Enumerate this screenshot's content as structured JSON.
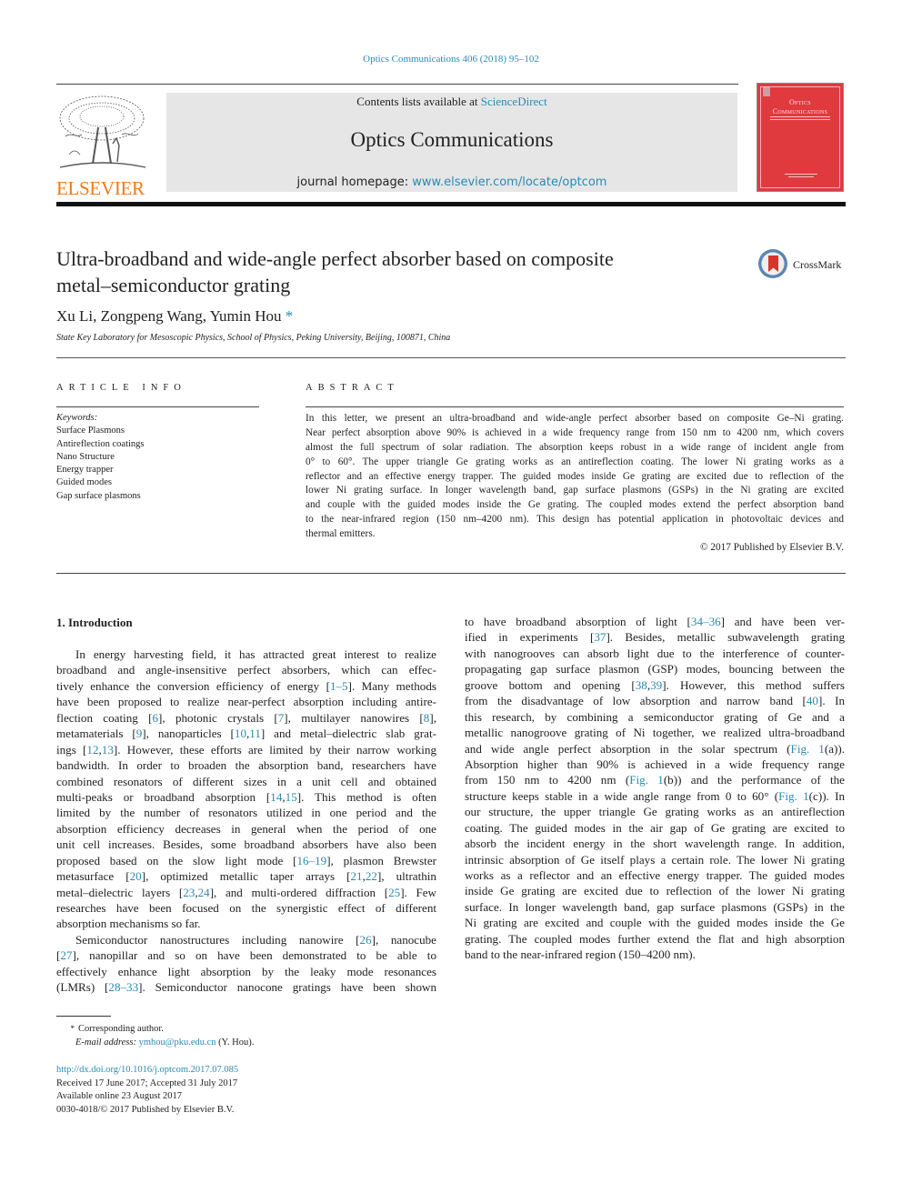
{
  "header": {
    "citation": "Optics Communications 406 (2018) 95–102",
    "publisher_logo_text": "ELSEVIER",
    "contents_prefix": "Contents lists available at ",
    "contents_link": "ScienceDirect",
    "journal_title": "Optics Communications",
    "homepage_prefix": "journal homepage: ",
    "homepage_link": "www.elsevier.com/locate/optcom",
    "cover_title_line1": "Optics",
    "cover_title_line2": "Communications",
    "crossmark_label": "CrossMark",
    "colors": {
      "link": "#2a8ab3",
      "elsevier_orange": "#f07a1a",
      "cover_red": "#e03a3f",
      "masthead_gray": "#e6e6e6"
    }
  },
  "article": {
    "title_line1": "Ultra-broadband and wide-angle perfect absorber based on composite",
    "title_line2": "metal–semiconductor grating",
    "authors": "Xu Li, Zongpeng Wang, Yumin Hou",
    "corresponding_mark": "*",
    "affiliation": "State Key Laboratory for Mesoscopic Physics, School of Physics, Peking University, Beijing, 100871, China"
  },
  "article_info": {
    "heading": "ARTICLE INFO",
    "keywords_label": "Keywords:",
    "keywords": [
      "Surface Plasmons",
      "Antireflection coatings",
      "Nano Structure",
      "Energy trapper",
      "Guided modes",
      "Gap surface plasmons"
    ]
  },
  "abstract": {
    "heading": "ABSTRACT",
    "lines": [
      "In this letter, we present an ultra-broadband and wide-angle perfect absorber based on composite Ge–Ni grating.",
      "Near perfect absorption above 90% is achieved in a wide frequency range from 150 nm to 4200 nm, which covers",
      "almost the full spectrum of solar radiation. The absorption keeps robust in a wide range of incident angle from",
      "0°  to 60°. The upper triangle Ge grating works as an antireflection coating. The lower Ni grating works as a",
      "reflector and an effective energy trapper. The guided modes inside Ge grating are excited due to reflection of the",
      "lower Ni grating surface. In longer wavelength band, gap surface plasmons (GSPs) in the Ni grating are excited",
      "and couple with the guided modes inside the Ge grating. The coupled modes extend the perfect absorption band",
      "to the near-infrared region (150 nm–4200 nm). This design has potential application in photovoltaic devices and",
      "thermal emitters."
    ],
    "copyright": "© 2017 Published by Elsevier B.V."
  },
  "introduction": {
    "heading": "1.  Introduction",
    "col1": [
      {
        "segs": [
          {
            "t": "In energy harvesting field, it has attracted great interest to realize"
          }
        ],
        "indent": true
      },
      {
        "segs": [
          {
            "t": "broadband and angle-insensitive perfect absorbers, which can effec-"
          }
        ]
      },
      {
        "segs": [
          {
            "t": "tively enhance the conversion efficiency of energy ["
          },
          {
            "t": "1–5",
            "l": 1
          },
          {
            "t": "]. Many methods"
          }
        ]
      },
      {
        "segs": [
          {
            "t": "have been proposed to realize near-perfect absorption including antire-"
          }
        ]
      },
      {
        "segs": [
          {
            "t": "flection coating ["
          },
          {
            "t": "6",
            "l": 1
          },
          {
            "t": "], photonic crystals ["
          },
          {
            "t": "7",
            "l": 1
          },
          {
            "t": "], multilayer nanowires ["
          },
          {
            "t": "8",
            "l": 1
          },
          {
            "t": "],"
          }
        ]
      },
      {
        "segs": [
          {
            "t": "metamaterials ["
          },
          {
            "t": "9",
            "l": 1
          },
          {
            "t": "], nanoparticles ["
          },
          {
            "t": "10",
            "l": 1
          },
          {
            "t": ","
          },
          {
            "t": "11",
            "l": 1
          },
          {
            "t": "] and metal–dielectric slab grat-"
          }
        ]
      },
      {
        "segs": [
          {
            "t": "ings ["
          },
          {
            "t": "12",
            "l": 1
          },
          {
            "t": ","
          },
          {
            "t": "13",
            "l": 1
          },
          {
            "t": "]. However, these efforts are limited by their narrow working"
          }
        ]
      },
      {
        "segs": [
          {
            "t": "bandwidth. In order to broaden the absorption band, researchers have"
          }
        ]
      },
      {
        "segs": [
          {
            "t": "combined resonators of different sizes in a unit cell and obtained"
          }
        ]
      },
      {
        "segs": [
          {
            "t": "multi-peaks or broadband absorption ["
          },
          {
            "t": "14",
            "l": 1
          },
          {
            "t": ","
          },
          {
            "t": "15",
            "l": 1
          },
          {
            "t": "]. This method is often"
          }
        ]
      },
      {
        "segs": [
          {
            "t": "limited by the number of resonators utilized in one period and the"
          }
        ]
      },
      {
        "segs": [
          {
            "t": "absorption efficiency decreases in general when the period of one"
          }
        ]
      },
      {
        "segs": [
          {
            "t": "unit cell increases. Besides, some broadband absorbers have also been"
          }
        ]
      },
      {
        "segs": [
          {
            "t": "proposed based on the slow light mode ["
          },
          {
            "t": "16–19",
            "l": 1
          },
          {
            "t": "], plasmon Brewster"
          }
        ]
      },
      {
        "segs": [
          {
            "t": "metasurface ["
          },
          {
            "t": "20",
            "l": 1
          },
          {
            "t": "], optimized metallic taper arrays ["
          },
          {
            "t": "21",
            "l": 1
          },
          {
            "t": ","
          },
          {
            "t": "22",
            "l": 1
          },
          {
            "t": "], ultrathin"
          }
        ]
      },
      {
        "segs": [
          {
            "t": "metal–dielectric layers ["
          },
          {
            "t": "23",
            "l": 1
          },
          {
            "t": ","
          },
          {
            "t": "24",
            "l": 1
          },
          {
            "t": "], and multi-ordered diffraction ["
          },
          {
            "t": "25",
            "l": 1
          },
          {
            "t": "]. Few"
          }
        ]
      },
      {
        "segs": [
          {
            "t": "researches have been focused on the synergistic effect of different"
          }
        ]
      },
      {
        "segs": [
          {
            "t": "absorption mechanisms so far."
          }
        ],
        "last": true
      },
      {
        "segs": [
          {
            "t": "Semiconductor nanostructures including nanowire ["
          },
          {
            "t": "26",
            "l": 1
          },
          {
            "t": "], nanocube"
          }
        ],
        "indent": true
      },
      {
        "segs": [
          {
            "t": "["
          },
          {
            "t": "27",
            "l": 1
          },
          {
            "t": "], nanopillar and so on have been demonstrated to be able to"
          }
        ]
      },
      {
        "segs": [
          {
            "t": "effectively enhance light absorption by the leaky mode resonances"
          }
        ]
      },
      {
        "segs": [
          {
            "t": "(LMRs) ["
          },
          {
            "t": "28–33",
            "l": 1
          },
          {
            "t": "]. Semiconductor nanocone gratings have been shown"
          }
        ]
      }
    ],
    "col2": [
      {
        "segs": [
          {
            "t": "to have broadband absorption of light ["
          },
          {
            "t": "34–36",
            "l": 1
          },
          {
            "t": "] and have been ver-"
          }
        ]
      },
      {
        "segs": [
          {
            "t": "ified in experiments ["
          },
          {
            "t": "37",
            "l": 1
          },
          {
            "t": "]. Besides, metallic subwavelength grating"
          }
        ]
      },
      {
        "segs": [
          {
            "t": "with nanogrooves can absorb light due to the interference of counter-"
          }
        ]
      },
      {
        "segs": [
          {
            "t": "propagating gap surface plasmon (GSP) modes, bouncing between the"
          }
        ]
      },
      {
        "segs": [
          {
            "t": "groove bottom and opening ["
          },
          {
            "t": "38",
            "l": 1
          },
          {
            "t": ","
          },
          {
            "t": "39",
            "l": 1
          },
          {
            "t": "]. However, this method suffers"
          }
        ]
      },
      {
        "segs": [
          {
            "t": "from the disadvantage of low absorption and narrow band ["
          },
          {
            "t": "40",
            "l": 1
          },
          {
            "t": "]. In"
          }
        ]
      },
      {
        "segs": [
          {
            "t": "this research, by combining a semiconductor grating of Ge and a"
          }
        ]
      },
      {
        "segs": [
          {
            "t": "metallic nanogroove grating of Ni together, we realized ultra-broadband"
          }
        ]
      },
      {
        "segs": [
          {
            "t": "and wide angle perfect absorption in the solar spectrum ("
          },
          {
            "t": "Fig. 1",
            "l": 1
          },
          {
            "t": "(a))."
          }
        ]
      },
      {
        "segs": [
          {
            "t": "Absorption higher than 90% is achieved in a wide frequency range"
          }
        ]
      },
      {
        "segs": [
          {
            "t": "from 150 nm to 4200 nm ("
          },
          {
            "t": "Fig. 1",
            "l": 1
          },
          {
            "t": "(b)) and the performance of the"
          }
        ]
      },
      {
        "segs": [
          {
            "t": "structure keeps stable in a wide angle range from 0 to 60° ("
          },
          {
            "t": "Fig. 1",
            "l": 1
          },
          {
            "t": "(c)). In"
          }
        ]
      },
      {
        "segs": [
          {
            "t": "our structure, the upper triangle Ge grating works as an antireflection"
          }
        ]
      },
      {
        "segs": [
          {
            "t": "coating. The guided modes in the air gap of Ge grating are excited to"
          }
        ]
      },
      {
        "segs": [
          {
            "t": "absorb the incident energy in the short wavelength range. In addition,"
          }
        ]
      },
      {
        "segs": [
          {
            "t": "intrinsic absorption of Ge itself plays a certain role. The lower Ni grating"
          }
        ]
      },
      {
        "segs": [
          {
            "t": "works as a reflector and an effective energy trapper. The guided modes"
          }
        ]
      },
      {
        "segs": [
          {
            "t": "inside Ge grating are excited due to reflection of the lower Ni grating"
          }
        ]
      },
      {
        "segs": [
          {
            "t": "surface. In longer wavelength band, gap surface plasmons (GSPs) in the"
          }
        ]
      },
      {
        "segs": [
          {
            "t": "Ni grating are excited and couple with the guided modes inside the Ge"
          }
        ]
      },
      {
        "segs": [
          {
            "t": "grating. The coupled modes further extend the flat and high absorption"
          }
        ]
      },
      {
        "segs": [
          {
            "t": "band to the near-infrared region (150–4200 nm)."
          }
        ],
        "last": true
      }
    ]
  },
  "footnote": {
    "mark": "*",
    "corresponding": "Corresponding author.",
    "email_label": "E-mail address:",
    "email": "ymhou@pku.edu.cn",
    "email_suffix": " (Y. Hou)."
  },
  "article_meta": {
    "doi": "http://dx.doi.org/10.1016/j.optcom.2017.07.085",
    "received": "Received 17 June 2017; Accepted 31 July 2017",
    "available": "Available online 23 August 2017",
    "issn_copyright": "0030-4018/© 2017 Published by Elsevier B.V."
  }
}
